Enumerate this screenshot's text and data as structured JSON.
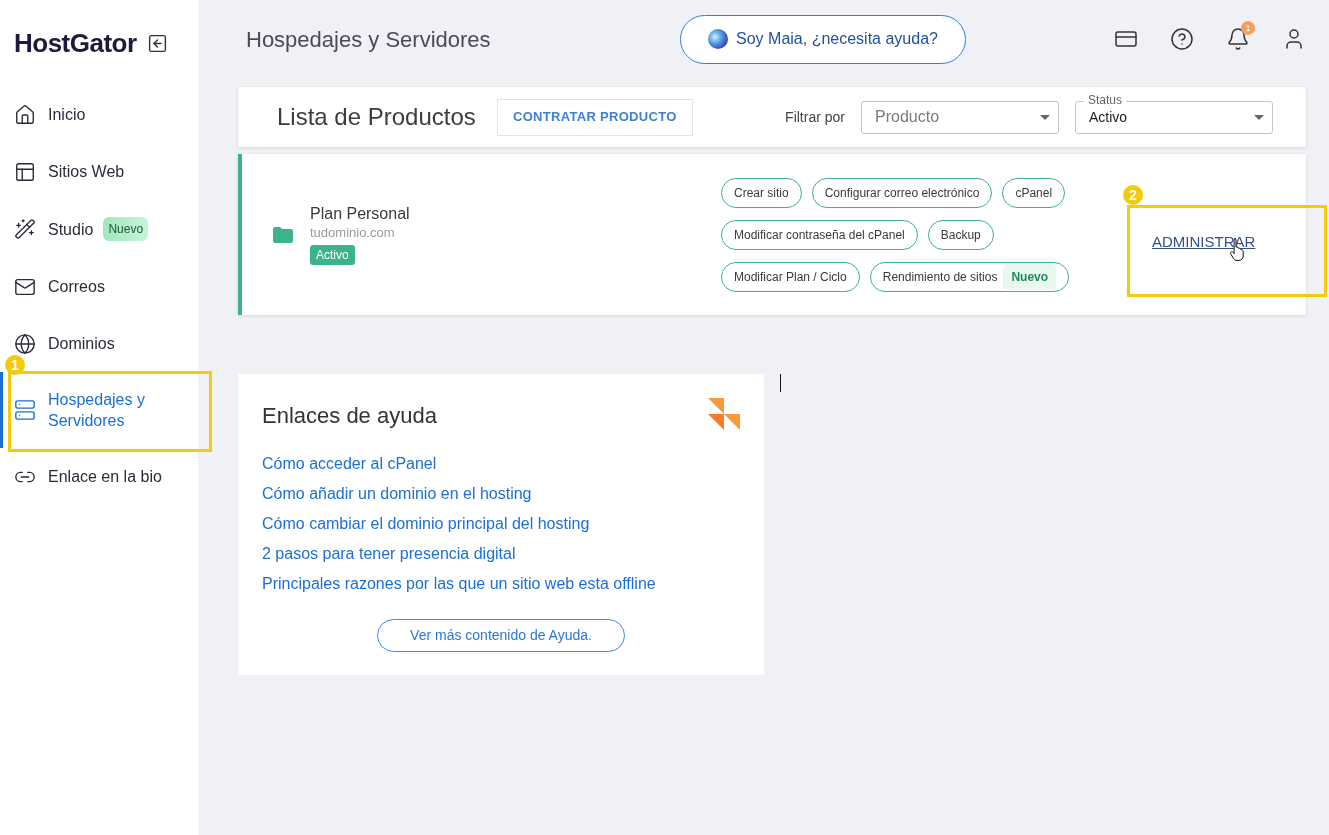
{
  "sidebar": {
    "logo": "HostGator",
    "items": [
      {
        "label": "Inicio",
        "selected": false
      },
      {
        "label": "Sitios Web",
        "selected": false
      },
      {
        "label": "Studio",
        "badge": "Nuevo",
        "selected": false
      },
      {
        "label": "Correos",
        "selected": false
      },
      {
        "label": "Dominios",
        "selected": false
      },
      {
        "label": "Hospedajes y Servidores",
        "selected": true
      },
      {
        "label": "Enlace en la bio",
        "selected": false
      }
    ]
  },
  "header": {
    "title": "Hospedajes y Servidores",
    "assistant_button": "Soy Maia, ¿necesita ayuda?",
    "notification_count": "1"
  },
  "products_toolbar": {
    "title": "Lista de Productos",
    "button": "CONTRATAR PRODUCTO",
    "filter_label": "Filtrar por",
    "product_filter": {
      "placeholder": "Producto"
    },
    "status_filter": {
      "label": "Status",
      "value": "Activo"
    }
  },
  "products": [
    {
      "name": "Plan Personal",
      "domain": "tudominio.com",
      "status": "Activo",
      "actions": [
        {
          "label": "Crear sitio"
        },
        {
          "label": "Configurar correo electrónico"
        },
        {
          "label": "cPanel"
        },
        {
          "label": "Modificar contraseña del cPanel"
        },
        {
          "label": "Backup"
        },
        {
          "label": "Modificar Plan / Ciclo"
        },
        {
          "label": "Rendimiento de sitios",
          "badge": "Nuevo"
        }
      ],
      "manage_link": "ADMINISTRAR"
    }
  ],
  "help": {
    "title": "Enlaces de ayuda",
    "links": [
      "Cómo acceder al cPanel",
      "Cómo añadir un dominio en el hosting",
      "Cómo cambiar el dominio principal del hosting",
      "2 pasos para tener presencia digital",
      "Principales razones por las que un sitio web esta offline"
    ],
    "button": "Ver más contenido de Ayuda."
  },
  "annotations": [
    {
      "label": "1"
    },
    {
      "label": "2"
    }
  ]
}
